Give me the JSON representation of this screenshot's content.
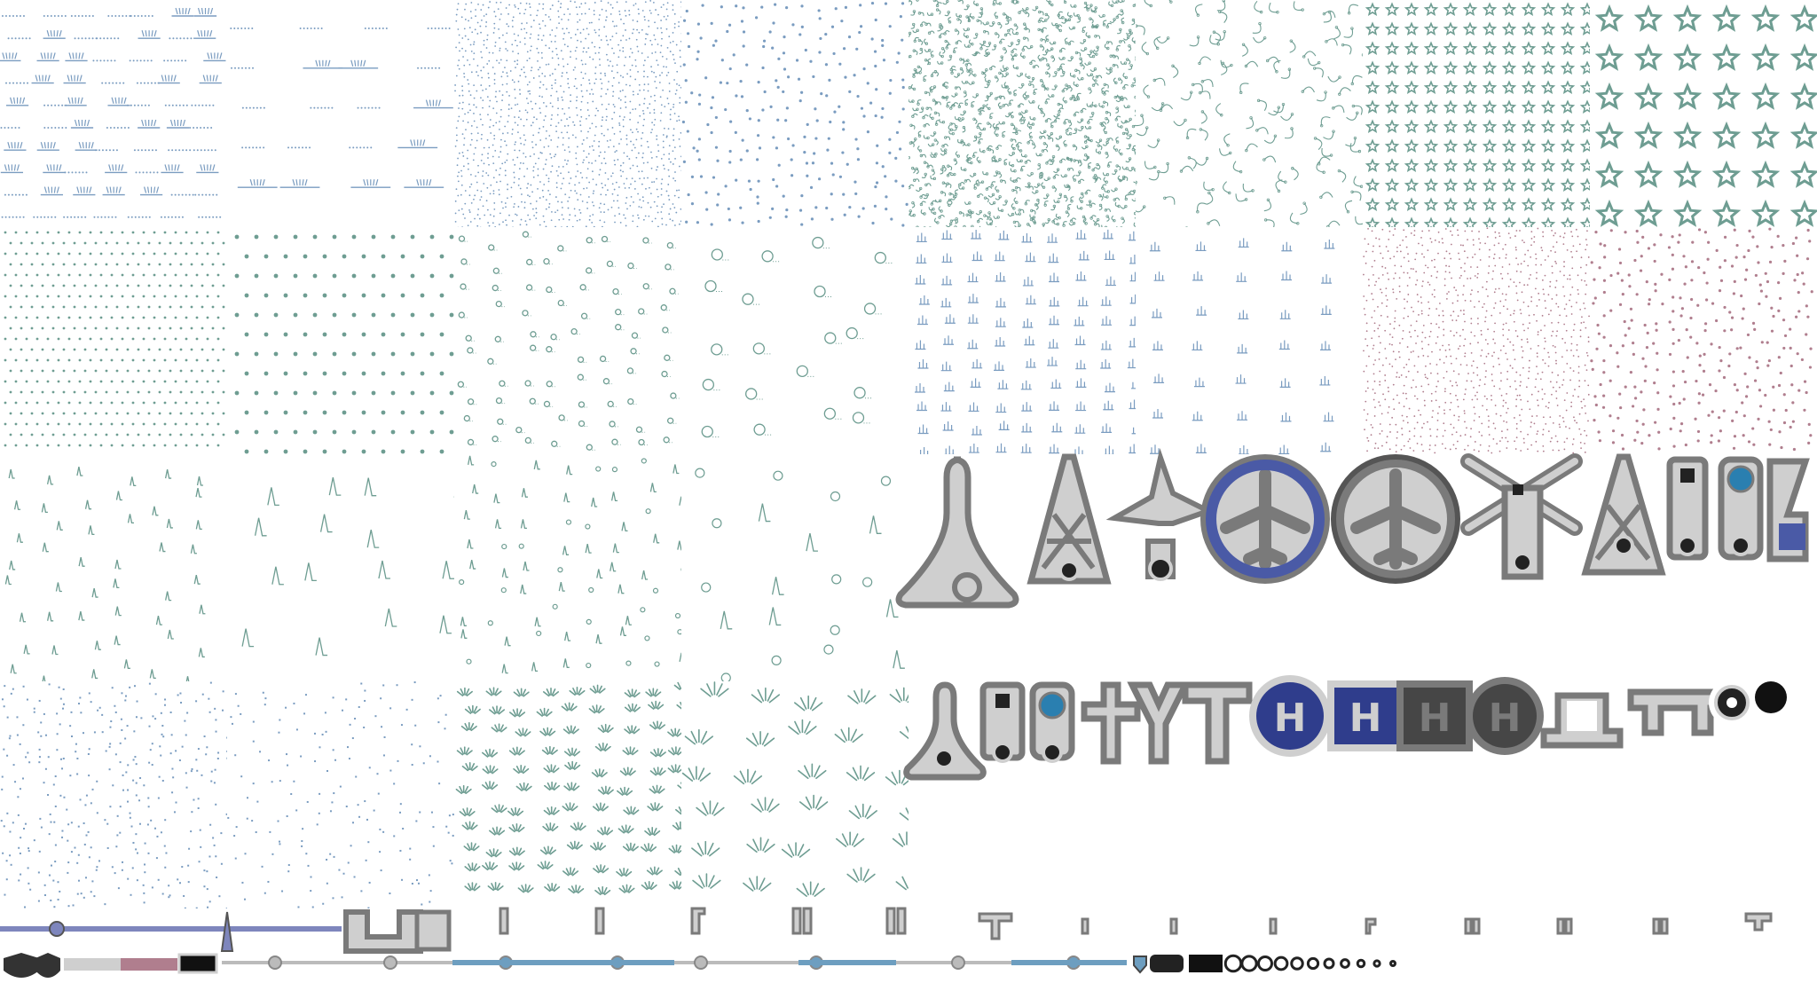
{
  "sheet": {
    "description_tiles": [
      "marsh-pattern",
      "marsh-pattern-large",
      "dot-pattern-fine",
      "dot-pattern-medium",
      "scrub-pattern-fine",
      "scrub-pattern-large",
      "star-pattern-small",
      "star-pattern-large",
      "dot-grid-fine",
      "dot-grid-large",
      "bubble-pattern-fine",
      "bubble-pattern-large",
      "grass-pattern-fine",
      "grass-pattern-large",
      "pink-dot-fine",
      "pink-dot-large",
      "cone-pattern-fine",
      "cone-pattern-large",
      "mixed-cone-bubble",
      "mixed-cone-bubble-large",
      "rock-pattern-fine",
      "rock-pattern-large",
      "fan-pattern-fine",
      "fan-pattern-large"
    ],
    "icons_row1": [
      "tower-icon",
      "lattice-tower-icon",
      "wind-turbine-icon",
      "airport-civil-icon",
      "airport-military-icon",
      "windmill-icon",
      "lattice-mast-icon",
      "beacon-square-icon",
      "beacon-round-icon",
      "mast-flag-icon"
    ],
    "icons_row2": [
      "peak-icon",
      "beacon-square-small-icon",
      "beacon-round-small-icon",
      "cross-icon",
      "fork-icon",
      "fork-tall-icon",
      "heliport-round-icon",
      "heliport-square-icon",
      "heliport-dark-icon",
      "heliport-dark-round-icon",
      "arch-icon",
      "gate-icon",
      "dot-icon",
      "black-dot-icon"
    ],
    "colors": {
      "blue_pattern": "#7a9cc0",
      "green_pattern": "#6e9d92",
      "pink_pattern": "#b07e8e",
      "icon_gray": "#7a7a7a",
      "icon_light": "#cfcfcf",
      "icon_blue": "#4a5aa6",
      "icon_navy": "#2f3d8c",
      "icon_dark": "#464646",
      "icon_teal": "#2a7fb0",
      "line_purple": "#7e86bd",
      "line_blue": "#6d9ec0"
    }
  }
}
